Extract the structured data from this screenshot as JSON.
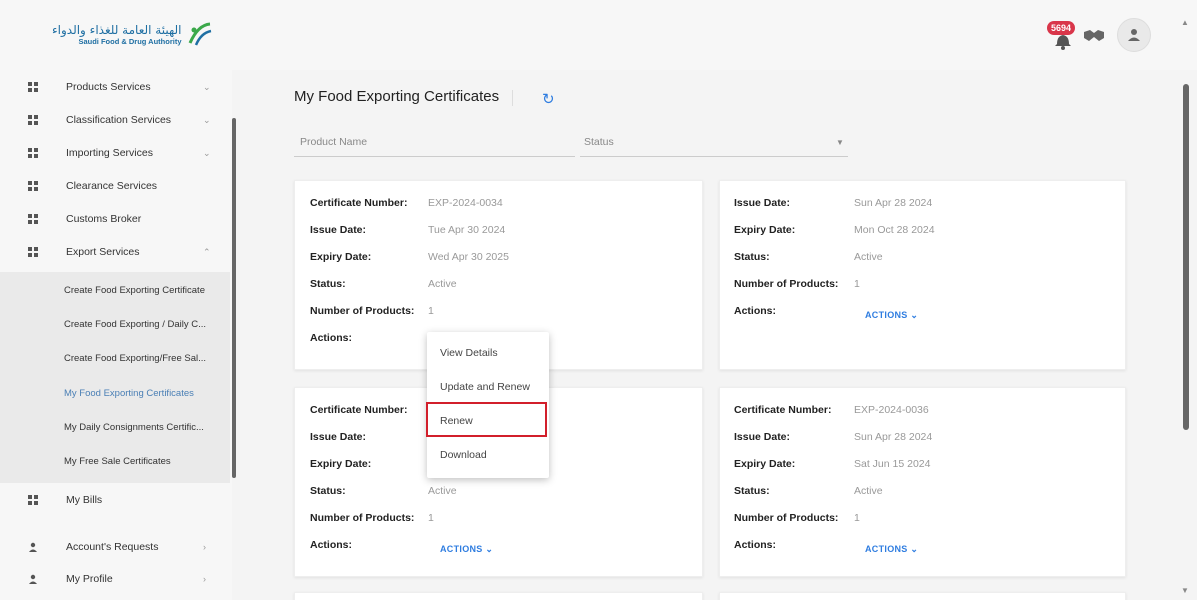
{
  "header": {
    "logo_ar": "الهيئة العامة للغذاء والدواء",
    "logo_en": "Saudi Food & Drug Authority",
    "notification_count": "5694"
  },
  "sidebar": {
    "items": [
      {
        "label": "Products Services",
        "caret": "⌄"
      },
      {
        "label": "Classification Services",
        "caret": "⌄"
      },
      {
        "label": "Importing Services",
        "caret": "⌄"
      },
      {
        "label": "Clearance Services",
        "caret": ""
      },
      {
        "label": "Customs Broker",
        "caret": ""
      },
      {
        "label": "Export Services",
        "caret": "⌃"
      }
    ],
    "sub_items": [
      "Create Food Exporting Certificate",
      "Create Food Exporting / Daily C...",
      "Create Food Exporting/Free Sal...",
      "My Food Exporting Certificates",
      "My Daily Consignments Certific...",
      "My Free Sale Certificates"
    ],
    "bottom_items": [
      {
        "label": "My Bills",
        "caret": ""
      },
      {
        "label": "Account's Requests",
        "caret": "›"
      },
      {
        "label": "My Profile",
        "caret": "›"
      }
    ]
  },
  "main": {
    "title": "My Food Exporting Certificates",
    "filters": {
      "product_name": "Product Name",
      "status": "Status"
    },
    "labels": {
      "certificate_number": "Certificate Number:",
      "issue_date": "Issue Date:",
      "expiry_date": "Expiry Date:",
      "status": "Status:",
      "number_of_products": "Number of Products:",
      "actions": "Actions:",
      "actions_button": "ACTIONS ⌄"
    },
    "cards": [
      {
        "certificate_number": "EXP-2024-0034",
        "issue_date": "Tue Apr 30 2024",
        "expiry_date": "Wed Apr 30 2025",
        "status": "Active",
        "number_of_products": "1"
      },
      {
        "issue_date": "Sun Apr 28 2024",
        "expiry_date": "Mon Oct 28 2024",
        "status": "Active",
        "number_of_products": "1"
      },
      {
        "status": "Active",
        "number_of_products": "1"
      },
      {
        "certificate_number": "EXP-2024-0036",
        "issue_date": "Sun Apr 28 2024",
        "expiry_date": "Sat Jun 15 2024",
        "status": "Active",
        "number_of_products": "1"
      }
    ],
    "dropdown": [
      "View Details",
      "Update and Renew",
      "Renew",
      "Download"
    ]
  }
}
